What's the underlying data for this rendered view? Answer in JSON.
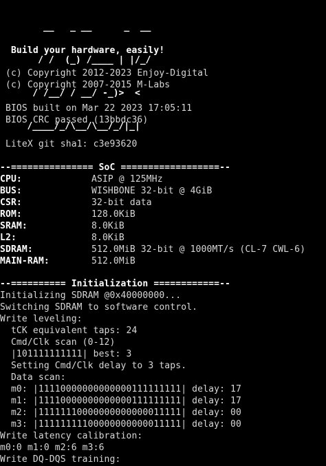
{
  "logo": {
    "lines": [
      "      __   _ __      _  __",
      "     / /  (_) /____ | |/_/",
      "    / /__/ / __/ -_)>  <",
      "   /____/_/\\__/\\__/_/|_|"
    ]
  },
  "tagline": "  Build your hardware, easily!",
  "copyright": [
    " (c) Copyright 2012-2023 Enjoy-Digital",
    " (c) Copyright 2007-2015 M-Labs"
  ],
  "bios": [
    " BIOS built on Mar 22 2023 17:05:11",
    " BIOS CRC passed (13bbdc36)"
  ],
  "git": " LiteX git sha1: c3e93620",
  "soc_header": "--=============== SoC ==================--",
  "soc": [
    {
      "key": "CPU:",
      "value": "ASIP @ 125MHz"
    },
    {
      "key": "BUS:",
      "value": "WISHBONE 32-bit @ 4GiB"
    },
    {
      "key": "CSR:",
      "value": "32-bit data"
    },
    {
      "key": "ROM:",
      "value": "128.0KiB"
    },
    {
      "key": "SRAM:",
      "value": "8.0KiB"
    },
    {
      "key": "L2:",
      "value": "8.0KiB"
    },
    {
      "key": "SDRAM:",
      "value": "512.0MiB 32-bit @ 1000MT/s (CL-7 CWL-6)"
    },
    {
      "key": "MAIN-RAM:",
      "value": "512.0MiB"
    }
  ],
  "init_header": "--========== Initialization ============--",
  "init": [
    "Initializing SDRAM @0x40000000...",
    "Switching SDRAM to software control.",
    "Write leveling:",
    "  tCK equivalent taps: 24",
    "  Cmd/Clk scan (0-12)",
    "  |101111111111| best: 3",
    "  Setting Cmd/Clk delay to 3 taps.",
    "  Data scan:",
    "  m0: |11110000000000000111111111| delay: 17",
    "  m1: |11110000000000000111111111| delay: 17",
    "  m2: |11111110000000000000011111| delay: 00",
    "  m3: |11111111100000000000011111| delay: 00",
    "Write latency calibration:",
    "m0:0 m1:0 m2:6 m3:6",
    "Write DQ-DQS training:"
  ]
}
